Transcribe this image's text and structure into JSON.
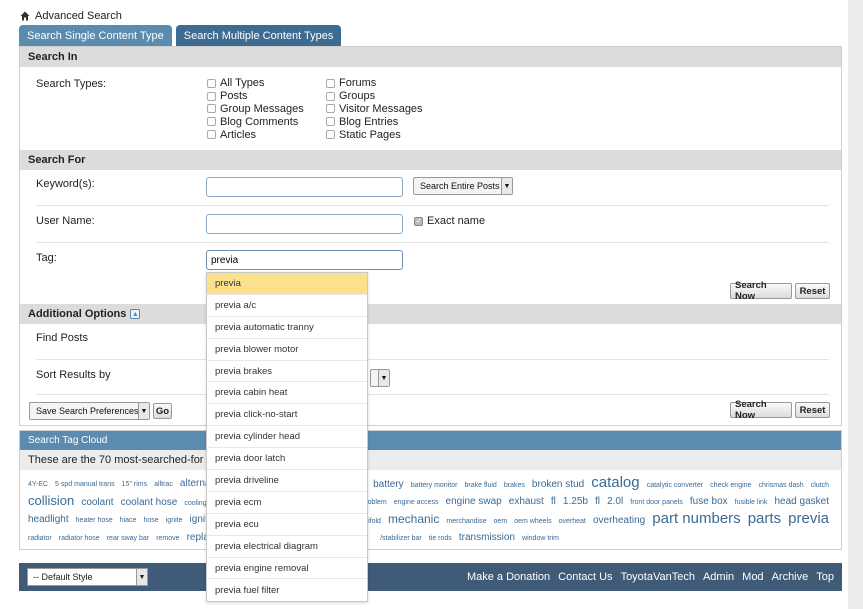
{
  "breadcrumb": {
    "label": "Advanced Search"
  },
  "tabs": [
    {
      "label": "Search Single Content Type"
    },
    {
      "label": "Search Multiple Content Types"
    }
  ],
  "search_in": {
    "title": "Search In",
    "types_label": "Search Types:",
    "types": [
      "All Types",
      "Forums",
      "Posts",
      "Groups",
      "Group Messages",
      "Visitor Messages",
      "Blog Comments",
      "Blog Entries",
      "Articles",
      "Static Pages"
    ]
  },
  "search_for": {
    "title": "Search For",
    "keyword_label": "Keyword(s):",
    "keyword_value": "",
    "scope_select": "Search Entire Posts",
    "username_label": "User Name:",
    "username_value": "",
    "exact_name_label": "Exact name",
    "tag_label": "Tag:",
    "tag_value": "previa",
    "search_now": "Search Now",
    "reset": "Reset"
  },
  "additional": {
    "title": "Additional Options",
    "find_posts_label": "Find Posts",
    "sort_label": "Sort Results by",
    "prefs_select": "Save Search Preferences",
    "go": "Go",
    "search_now": "Search Now",
    "reset": "Reset"
  },
  "tag_suggestions": [
    "previa",
    "previa a/c",
    "previa automatic tranny",
    "previa blower motor",
    "previa brakes",
    "previa cabin heat",
    "previa click-no-start",
    "previa cylinder head",
    "previa door latch",
    "previa driveline",
    "previa ecm",
    "previa ecu",
    "previa electrical diagram",
    "previa engine removal",
    "previa fuel filter"
  ],
  "tag_cloud": {
    "title": "Search Tag Cloud",
    "intro": "These are the 70 most-searched-for th",
    "line1_left": [
      "4Y-EC",
      "5 spd manual trans",
      "15\" rims",
      "alltrac",
      "alternato"
    ],
    "line1_right": [
      "wnings",
      "battery",
      "battery monitor",
      "brake fluid",
      "brakes",
      "broken stud",
      "catalog",
      "catalytic converter",
      "check engine",
      "chrismas dash",
      "clutch"
    ],
    "line2_left": [
      "collision",
      "coolant",
      "coolant hose",
      "cooling sys"
    ],
    "line2_right": [
      "lectrical problem",
      "engine access",
      "engine swap",
      "exhaust",
      "fl",
      "1.25b",
      "fl",
      "2.0l",
      "front door panels",
      "fuse box",
      "fusible link",
      "head gasket"
    ],
    "line3_left": [
      "headlight",
      "heater hose",
      "hiace",
      "hose",
      "ignite",
      "ignition s"
    ],
    "line3_right": [
      "nifold",
      "mechanic",
      "merchandise",
      "oem",
      "oem wheels",
      "overheat",
      "overheating",
      "part numbers",
      "parts",
      "previa"
    ],
    "line4_left": [
      "radiator",
      "radiator hose",
      "rear sway bar",
      "remove",
      "replace"
    ],
    "line4_right": [
      "/stabilizer bar",
      "tie rods",
      "transmission",
      "window trim"
    ]
  },
  "footer": {
    "style_select": "-- Default Style",
    "links": [
      "Make a Donation",
      "Contact Us",
      "ToyotaVanTech",
      "Admin",
      "Mod",
      "Archive",
      "Top"
    ]
  }
}
